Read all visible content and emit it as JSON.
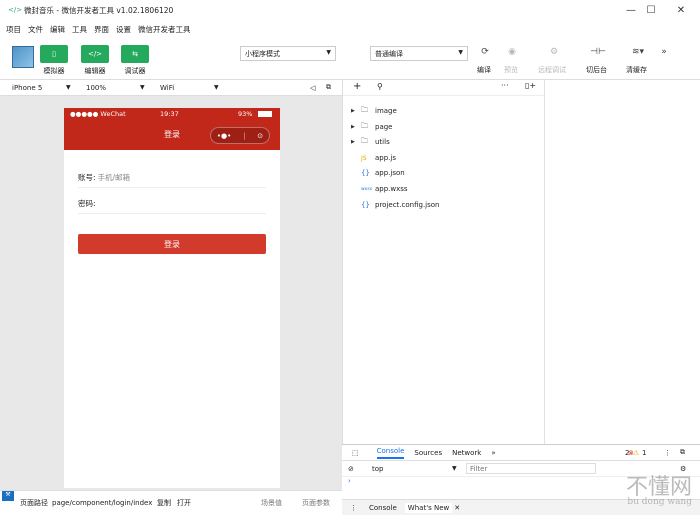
{
  "window": {
    "title": "微封音乐 - 微信开发者工具 v1.02.1806120",
    "controls": {
      "minimize": "—",
      "maximize": "☐",
      "close": "✕"
    }
  },
  "menu": [
    "项目",
    "文件",
    "编辑",
    "工具",
    "界面",
    "设置",
    "微信开发者工具"
  ],
  "toolbar": {
    "simulator_label": "模拟器",
    "editor_label": "编辑器",
    "debugger_label": "调试器",
    "mode_select": "小程序模式",
    "compile_select": "普通编译",
    "compile_label": "编译",
    "preview_label": "预览",
    "remote_debug_label": "远程调试",
    "background_label": "切后台",
    "clear_cache_label": "清缓存",
    "more_icon": "»"
  },
  "device_bar": {
    "device": "iPhone 5",
    "zoom": "100%",
    "network": "WiFi"
  },
  "phone": {
    "status_carrier": "●●●●● WeChat",
    "status_time": "19:37",
    "status_battery": "93%",
    "nav_title": "登录",
    "account_label": "账号:",
    "account_placeholder": "手机/邮箱",
    "password_label": "密码:",
    "login_button": "登录"
  },
  "bottom_bar": {
    "path_label": "页面路径",
    "path_value": "page/component/login/index",
    "copy_label": "复制",
    "open_label": "打开",
    "scene_label": "场景值",
    "params_label": "页面参数"
  },
  "explorer": {
    "items": [
      {
        "name": "image",
        "type": "folder"
      },
      {
        "name": "page",
        "type": "folder"
      },
      {
        "name": "utils",
        "type": "folder"
      },
      {
        "name": "app.js",
        "type": "js"
      },
      {
        "name": "app.json",
        "type": "json"
      },
      {
        "name": "app.wxss",
        "type": "wxss"
      },
      {
        "name": "project.config.json",
        "type": "json"
      }
    ]
  },
  "console": {
    "tabs": [
      "Console",
      "Sources",
      "Network"
    ],
    "context": "top",
    "filter_placeholder": "Filter",
    "errors": "2",
    "warnings": "1",
    "drawer_tab1": "Console",
    "drawer_tab2": "What's New"
  },
  "watermark": {
    "main": "不懂网",
    "sub": "bu dong wang"
  },
  "colors": {
    "accent_green": "#24a95d",
    "nav_red": "#c1281a",
    "button_red": "#d23a2c"
  }
}
